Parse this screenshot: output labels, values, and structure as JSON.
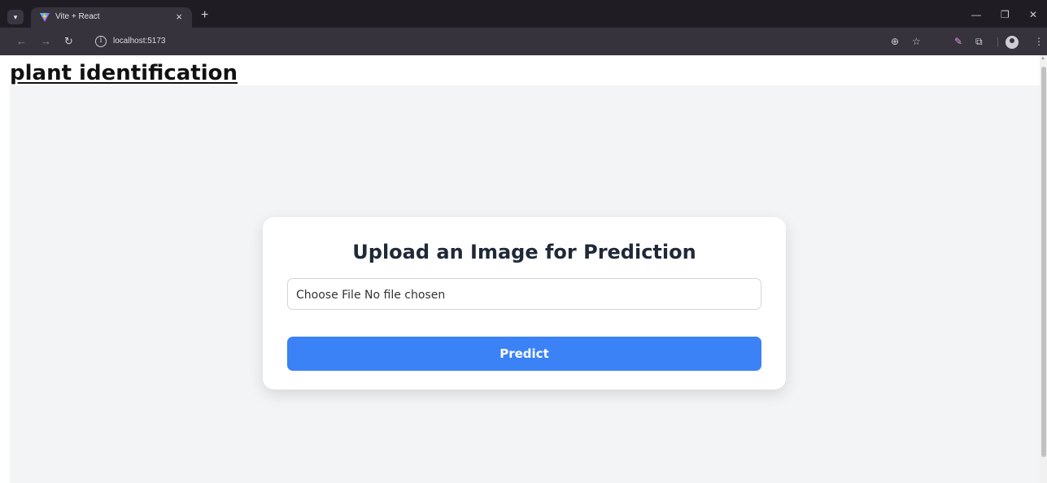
{
  "browser": {
    "tab_title": "Vite + React",
    "tab_close": "×",
    "new_tab": "+",
    "url": "localhost:5173",
    "icons": [
      "tab-menu-chevron-icon",
      "vite-favicon-icon",
      "back-icon",
      "forward-icon",
      "reload-icon",
      "site-info-icon",
      "zoom-icon",
      "bookmark-star-icon",
      "extension-pen-icon",
      "extensions-icon",
      "profile-icon",
      "menu-dots-icon"
    ]
  },
  "page": {
    "title": "plant identification"
  },
  "card": {
    "heading": "Upload an Image for Prediction",
    "file_input_text": "Choose File No file chosen",
    "predict_label": "Predict"
  },
  "colors": {
    "chrome_dark": "#1f1c23",
    "chrome_toolbar": "#37333c",
    "app_background": "#f3f4f6",
    "button_blue": "#3b82f6",
    "heading_text": "#1f2937"
  }
}
